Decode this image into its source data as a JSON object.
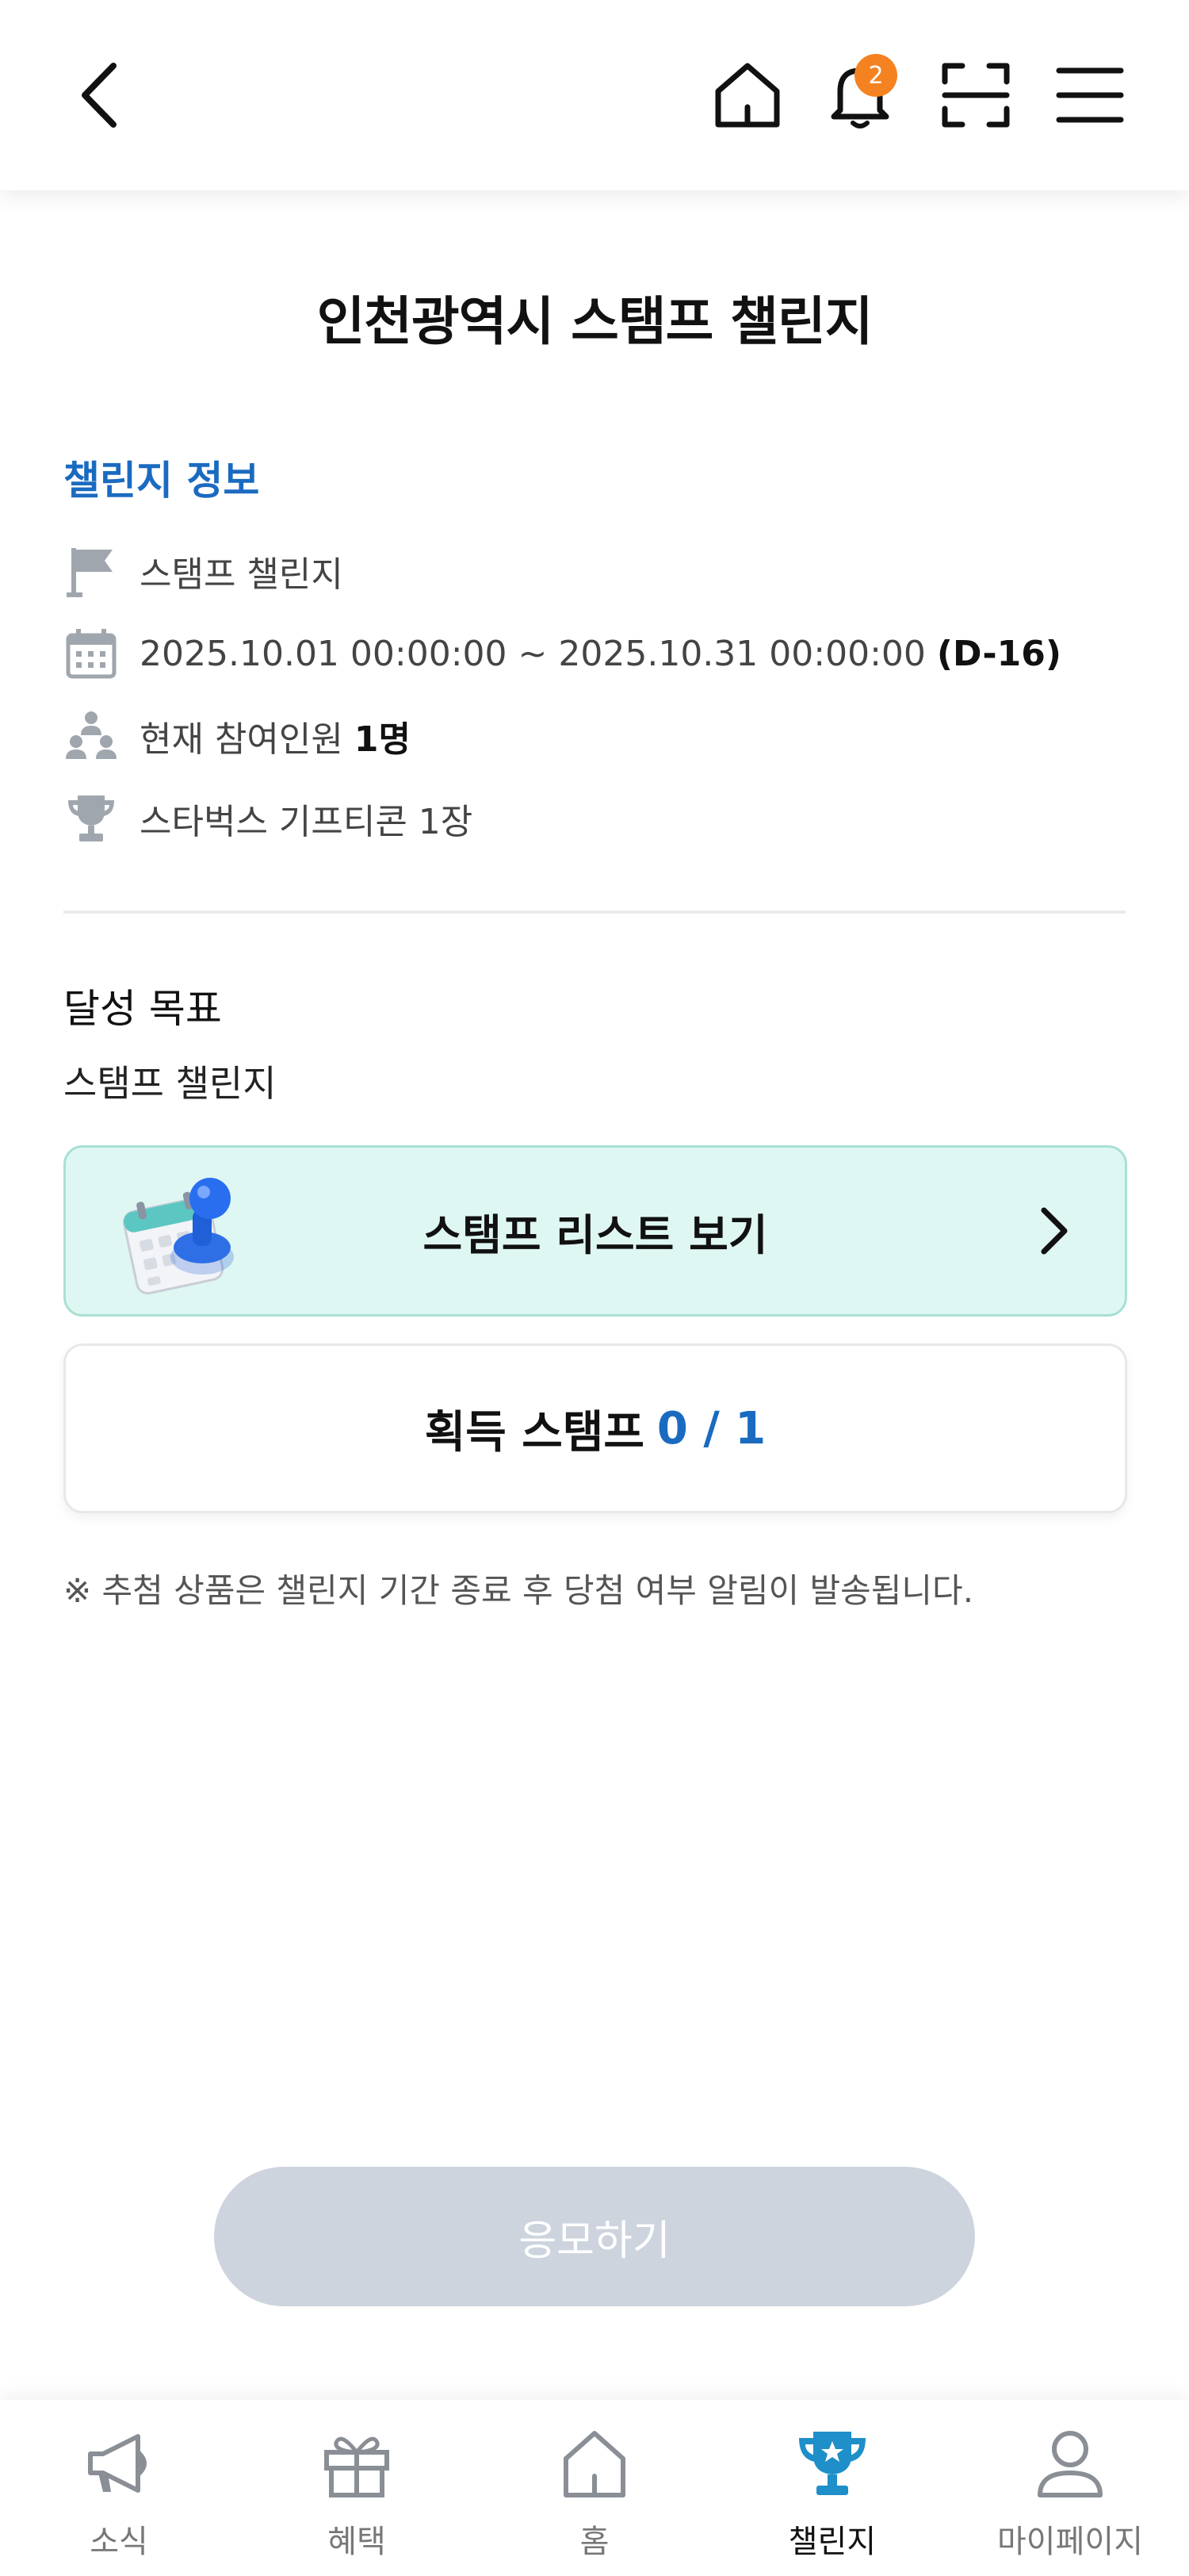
{
  "header": {
    "back_icon": "chevron-left-icon",
    "notification_count": "2"
  },
  "page": {
    "title": "인천광역시 스탬프 챌린지"
  },
  "challenge_info": {
    "section_title": "챌린지 정보",
    "type": "스탬프 챌린지",
    "period": "2025.10.01 00:00:00 ~ 2025.10.31 00:00:00",
    "dday": "(D-16)",
    "participants_label": "현재 참여인원",
    "participants_value": "1명",
    "prize": "스타벅스 기프티콘 1장"
  },
  "goal": {
    "title": "달성 목표",
    "text": "스탬프 챌린지"
  },
  "stamp_list_button": "스탬프 리스트 보기",
  "acquired": {
    "label": "획득 스탬프",
    "value": "0 / 1"
  },
  "notice": "※ 추첨 상품은 챌린지 기간 종료 후 당첨 여부 알림이 발송됩니다.",
  "apply_button": "응모하기",
  "bottom_nav": {
    "items": [
      {
        "label": "소식",
        "icon": "megaphone-icon"
      },
      {
        "label": "혜택",
        "icon": "gift-icon"
      },
      {
        "label": "홈",
        "icon": "home-icon"
      },
      {
        "label": "챌린지",
        "icon": "trophy-icon"
      },
      {
        "label": "마이페이지",
        "icon": "person-icon"
      }
    ],
    "active": "챌린지"
  },
  "colors": {
    "accent_blue": "#1a6bc0",
    "badge_orange": "#f58220",
    "card_mint": "#dff7f3",
    "disabled_button": "#cdd4de",
    "active_trophy": "#1e8fc9"
  }
}
